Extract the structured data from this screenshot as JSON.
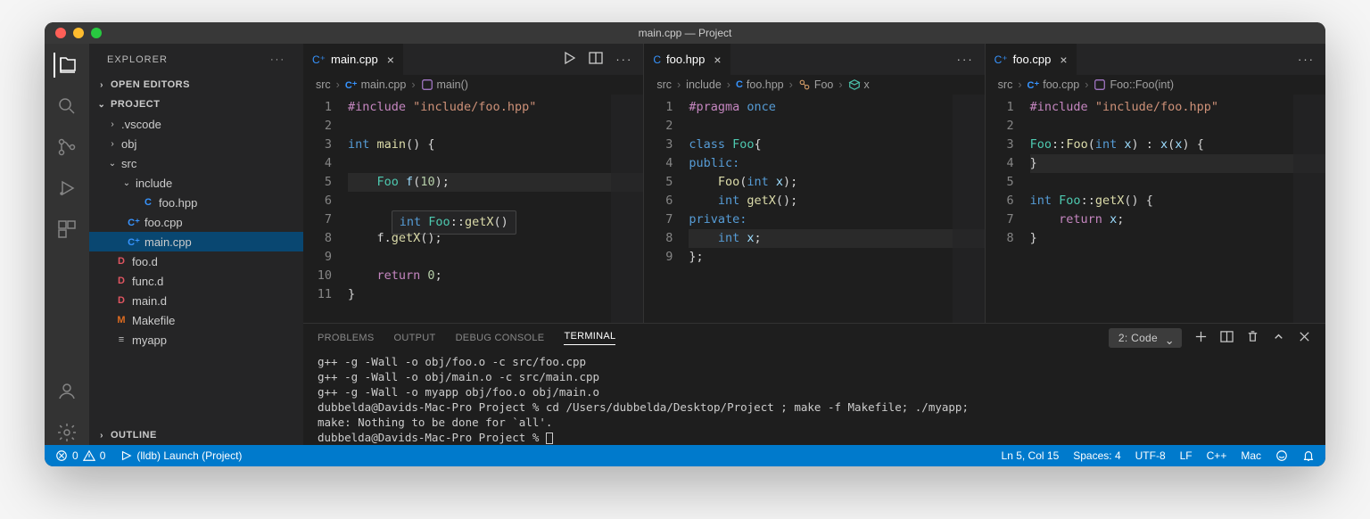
{
  "window_title": "main.cpp — Project",
  "explorer": {
    "title": "EXPLORER",
    "open_editors_label": "OPEN EDITORS",
    "project_label": "PROJECT",
    "outline_label": "OUTLINE",
    "tree": {
      "vscode": ".vscode",
      "obj": "obj",
      "src": "src",
      "include": "include",
      "foo_hpp": "foo.hpp",
      "foo_cpp": "foo.cpp",
      "main_cpp": "main.cpp",
      "foo_d": "foo.d",
      "func_d": "func.d",
      "main_d": "main.d",
      "makefile": "Makefile",
      "myapp": "myapp"
    }
  },
  "groups": [
    {
      "tab_label": "main.cpp",
      "breadcrumbs": {
        "p1": "src",
        "p2": "main.cpp",
        "p3": "main()"
      },
      "hint": "int Foo::getX()",
      "code": {
        "l1_a": "#include ",
        "l1_b": "\"include/foo.hpp\"",
        "l3_a": "int ",
        "l3_b": "main",
        "l3_c": "() {",
        "l5_a": "    Foo ",
        "l5_b": "f",
        "l5_c": "(",
        "l5_d": "10",
        "l5_e": ");",
        "l8_a": "    f.",
        "l8_b": "getX",
        "l8_c": "();",
        "l10_a": "    ",
        "l10_b": "return ",
        "l10_c": "0",
        "l10_d": ";",
        "l11": "}"
      }
    },
    {
      "tab_label": "foo.hpp",
      "breadcrumbs": {
        "p1": "src",
        "p2": "include",
        "p3": "foo.hpp",
        "p4": "Foo",
        "p5": "x"
      },
      "code": {
        "l1_a": "#pragma ",
        "l1_b": "once",
        "l3_a": "class ",
        "l3_b": "Foo",
        "l3_c": "{",
        "l4": "public:",
        "l5_a": "    ",
        "l5_b": "Foo",
        "l5_c": "(",
        "l5_d": "int ",
        "l5_e": "x",
        "l5_f": ");",
        "l6_a": "    ",
        "l6_b": "int ",
        "l6_c": "getX",
        "l6_d": "();",
        "l7": "private:",
        "l8_a": "    ",
        "l8_b": "int ",
        "l8_c": "x",
        "l8_d": ";",
        "l9": "};"
      }
    },
    {
      "tab_label": "foo.cpp",
      "breadcrumbs": {
        "p1": "src",
        "p2": "foo.cpp",
        "p3": "Foo::Foo(int)"
      },
      "code": {
        "l1_a": "#include ",
        "l1_b": "\"include/foo.hpp\"",
        "l3_a": "Foo",
        "l3_b": "::",
        "l3_c": "Foo",
        "l3_d": "(",
        "l3_e": "int ",
        "l3_f": "x",
        "l3_g": ") : ",
        "l3_h": "x",
        "l3_i": "(",
        "l3_j": "x",
        "l3_k": ") {",
        "l4": "}",
        "l6_a": "int ",
        "l6_b": "Foo",
        "l6_c": "::",
        "l6_d": "getX",
        "l6_e": "() {",
        "l7_a": "    ",
        "l7_b": "return ",
        "l7_c": "x",
        "l7_d": ";",
        "l8": "}"
      }
    }
  ],
  "panel": {
    "tabs": {
      "problems": "PROBLEMS",
      "output": "OUTPUT",
      "debug": "DEBUG CONSOLE",
      "terminal": "TERMINAL"
    },
    "term_name": "2: Code",
    "terminal_lines": [
      "g++ -g -Wall -o obj/foo.o -c src/foo.cpp",
      "g++ -g -Wall -o obj/main.o -c src/main.cpp",
      "g++ -g -Wall -o myapp obj/foo.o obj/main.o",
      "dubbelda@Davids-Mac-Pro Project % cd /Users/dubbelda/Desktop/Project ; make -f Makefile; ./myapp;",
      "make: Nothing to be done for `all'.",
      "dubbelda@Davids-Mac-Pro Project % "
    ]
  },
  "status": {
    "errors": "0",
    "warnings": "0",
    "launch": "(lldb) Launch (Project)",
    "lncol": "Ln 5, Col 15",
    "spaces": "Spaces: 4",
    "encoding": "UTF-8",
    "eol": "LF",
    "lang": "C++",
    "os": "Mac"
  }
}
